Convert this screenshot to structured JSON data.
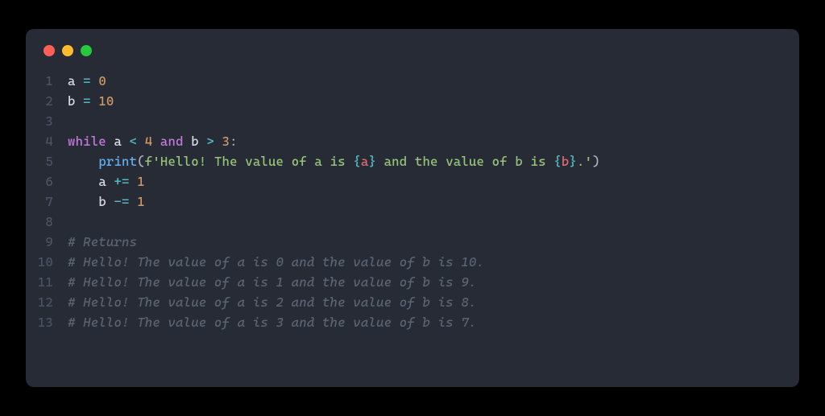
{
  "lines": [
    {
      "num": "1",
      "tokens": [
        {
          "cls": "tok-var",
          "t": "a"
        },
        {
          "cls": "",
          "t": " "
        },
        {
          "cls": "tok-op",
          "t": "="
        },
        {
          "cls": "",
          "t": " "
        },
        {
          "cls": "tok-num",
          "t": "0"
        }
      ]
    },
    {
      "num": "2",
      "tokens": [
        {
          "cls": "tok-var",
          "t": "b"
        },
        {
          "cls": "",
          "t": " "
        },
        {
          "cls": "tok-op",
          "t": "="
        },
        {
          "cls": "",
          "t": " "
        },
        {
          "cls": "tok-num",
          "t": "10"
        }
      ]
    },
    {
      "num": "3",
      "tokens": []
    },
    {
      "num": "4",
      "tokens": [
        {
          "cls": "tok-kw",
          "t": "while"
        },
        {
          "cls": "",
          "t": " "
        },
        {
          "cls": "tok-var",
          "t": "a"
        },
        {
          "cls": "",
          "t": " "
        },
        {
          "cls": "tok-op",
          "t": "<"
        },
        {
          "cls": "",
          "t": " "
        },
        {
          "cls": "tok-num",
          "t": "4"
        },
        {
          "cls": "",
          "t": " "
        },
        {
          "cls": "tok-kw",
          "t": "and"
        },
        {
          "cls": "",
          "t": " "
        },
        {
          "cls": "tok-var",
          "t": "b"
        },
        {
          "cls": "",
          "t": " "
        },
        {
          "cls": "tok-op",
          "t": ">"
        },
        {
          "cls": "",
          "t": " "
        },
        {
          "cls": "tok-num",
          "t": "3"
        },
        {
          "cls": "tok-colon",
          "t": ":"
        }
      ]
    },
    {
      "num": "5",
      "tokens": [
        {
          "cls": "",
          "t": "    "
        },
        {
          "cls": "tok-fn",
          "t": "print"
        },
        {
          "cls": "tok-paren",
          "t": "("
        },
        {
          "cls": "tok-str",
          "t": "f'Hello! The value of a is "
        },
        {
          "cls": "tok-brace",
          "t": "{"
        },
        {
          "cls": "tok-fvar",
          "t": "a"
        },
        {
          "cls": "tok-brace",
          "t": "}"
        },
        {
          "cls": "tok-str",
          "t": " and the value of b is "
        },
        {
          "cls": "tok-brace",
          "t": "{"
        },
        {
          "cls": "tok-fvar",
          "t": "b"
        },
        {
          "cls": "tok-brace",
          "t": "}"
        },
        {
          "cls": "tok-str",
          "t": ".'"
        },
        {
          "cls": "tok-paren",
          "t": ")"
        }
      ]
    },
    {
      "num": "6",
      "tokens": [
        {
          "cls": "",
          "t": "    "
        },
        {
          "cls": "tok-var",
          "t": "a"
        },
        {
          "cls": "",
          "t": " "
        },
        {
          "cls": "tok-op",
          "t": "+="
        },
        {
          "cls": "",
          "t": " "
        },
        {
          "cls": "tok-num",
          "t": "1"
        }
      ]
    },
    {
      "num": "7",
      "tokens": [
        {
          "cls": "",
          "t": "    "
        },
        {
          "cls": "tok-var",
          "t": "b"
        },
        {
          "cls": "",
          "t": " "
        },
        {
          "cls": "tok-op",
          "t": "-="
        },
        {
          "cls": "",
          "t": " "
        },
        {
          "cls": "tok-num",
          "t": "1"
        }
      ]
    },
    {
      "num": "8",
      "tokens": []
    },
    {
      "num": "9",
      "tokens": [
        {
          "cls": "tok-comment",
          "t": "# Returns"
        }
      ]
    },
    {
      "num": "10",
      "tokens": [
        {
          "cls": "tok-comment",
          "t": "# Hello! The value of a is 0 and the value of b is 10."
        }
      ]
    },
    {
      "num": "11",
      "tokens": [
        {
          "cls": "tok-comment",
          "t": "# Hello! The value of a is 1 and the value of b is 9."
        }
      ]
    },
    {
      "num": "12",
      "tokens": [
        {
          "cls": "tok-comment",
          "t": "# Hello! The value of a is 2 and the value of b is 8."
        }
      ]
    },
    {
      "num": "13",
      "tokens": [
        {
          "cls": "tok-comment",
          "t": "# Hello! The value of a is 3 and the value of b is 7."
        }
      ]
    }
  ]
}
